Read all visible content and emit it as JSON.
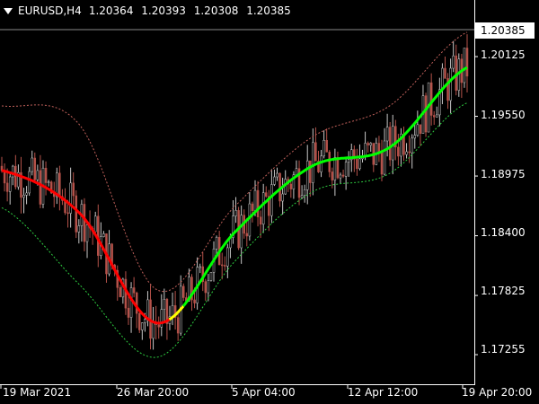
{
  "header": {
    "symbol": "EURUSD,H4",
    "open": "1.20364",
    "high": "1.20393",
    "low": "1.20308",
    "close": "1.20385",
    "menu_icon": "triangle-down-icon"
  },
  "current_price": "1.20385",
  "colors": {
    "background": "#000000",
    "candle_up": "#c8c8c8",
    "candle_down": "#b5524a",
    "upper_band": "#c0605a",
    "lower_band": "#2ecc40",
    "ma_down": "#ff0000",
    "ma_up": "#00ff00",
    "ma_neutral": "#ffff00",
    "axis": "#ffffff"
  },
  "y_axis_labels": [
    "1.20125",
    "1.19550",
    "1.18975",
    "1.18400",
    "1.17825",
    "1.17255"
  ],
  "x_axis_labels": [
    "19 Mar 2021",
    "26 Mar 20:00",
    "5 Apr 04:00",
    "12 Apr 12:00",
    "19 Apr 20:00"
  ],
  "chart_data": {
    "type": "line",
    "title": "EURUSD,H4",
    "categories": [
      "19 Mar 2021",
      "26 Mar 20:00",
      "5 Apr 04:00",
      "12 Apr 12:00",
      "19 Apr 20:00"
    ],
    "ylim": [
      1.1697,
      1.2067
    ],
    "y_ticks": [
      1.20125,
      1.1955,
      1.18975,
      1.184,
      1.17825,
      1.17255
    ],
    "series": [
      {
        "values": [
          1.1903,
          1.1862,
          1.1756,
          1.1843,
          1.1907,
          1.1925,
          1.2002
        ],
        "style": "trend-ma"
      },
      {
        "values": [
          1.1965,
          1.1947,
          1.1788,
          1.1868,
          1.1935,
          1.1965,
          1.2036
        ],
        "style": "dashed-upper"
      },
      {
        "values": [
          1.1867,
          1.1793,
          1.1723,
          1.1815,
          1.1882,
          1.19,
          1.1968
        ],
        "style": "dashed-lower"
      }
    ],
    "last_price": 1.20385
  }
}
